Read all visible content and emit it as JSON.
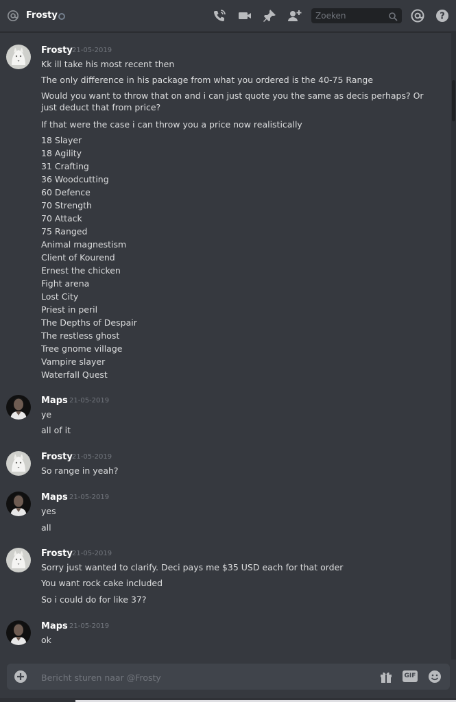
{
  "header": {
    "channel_name": "Frosty",
    "search_placeholder": "Zoeken"
  },
  "messages": [
    {
      "author": "Frosty",
      "timestamp": "21-05-2019",
      "avatar": "white-wolf",
      "lines": [
        "Kk ill take his most recent then",
        "The only difference in his package from what you ordered is the 40-75 Range",
        "Would you want to throw that on and i can just quote you the same as decis perhaps? Or just deduct that from price?",
        "If that were the case i can throw you a price now realistically",
        "18 Slayer",
        "18 Agility",
        "31 Crafting",
        "36 Woodcutting",
        "60 Defence",
        "70 Strength",
        "70 Attack",
        "75 Ranged",
        "Animal magnestism",
        "Client of Kourend",
        "Ernest the chicken",
        "Fight arena",
        "Lost City",
        "Priest in peril",
        "The Depths of Despair",
        "The restless ghost",
        "Tree gnome village",
        "Vampire slayer",
        "Waterfall Quest"
      ]
    },
    {
      "author": "Maps",
      "timestamp": "21-05-2019",
      "avatar": "dark-portrait",
      "lines": [
        "ye",
        "all of it"
      ]
    },
    {
      "author": "Frosty",
      "timestamp": "21-05-2019",
      "avatar": "white-wolf",
      "lines": [
        "So range in yeah?"
      ]
    },
    {
      "author": "Maps",
      "timestamp": "21-05-2019",
      "avatar": "dark-portrait",
      "lines": [
        "yes",
        "all"
      ]
    },
    {
      "author": "Frosty",
      "timestamp": "21-05-2019",
      "avatar": "white-wolf",
      "lines": [
        "Sorry just wanted to clarify. Deci pays me $35 USD each for that order",
        "You want rock cake included",
        "So i could do for like 37?"
      ]
    },
    {
      "author": "Maps",
      "timestamp": "21-05-2019",
      "avatar": "dark-portrait",
      "lines": [
        "ok"
      ]
    }
  ],
  "composer": {
    "placeholder": "Bericht sturen naar @Frosty",
    "gif_label": "GIF"
  },
  "icons": {
    "header": [
      "at-icon",
      "phone-call-icon",
      "video-call-icon",
      "pin-icon",
      "add-friend-icon",
      "search-icon",
      "mention-icon",
      "help-icon"
    ],
    "composer": [
      "plus-circle-icon",
      "gift-icon",
      "gif-icon",
      "emoji-icon"
    ]
  },
  "colors": {
    "background": "#36393f",
    "text": "#dcddde",
    "username": "#ffffff",
    "timestamp": "#72767d",
    "input_background": "#40444b",
    "search_background": "#202225"
  }
}
